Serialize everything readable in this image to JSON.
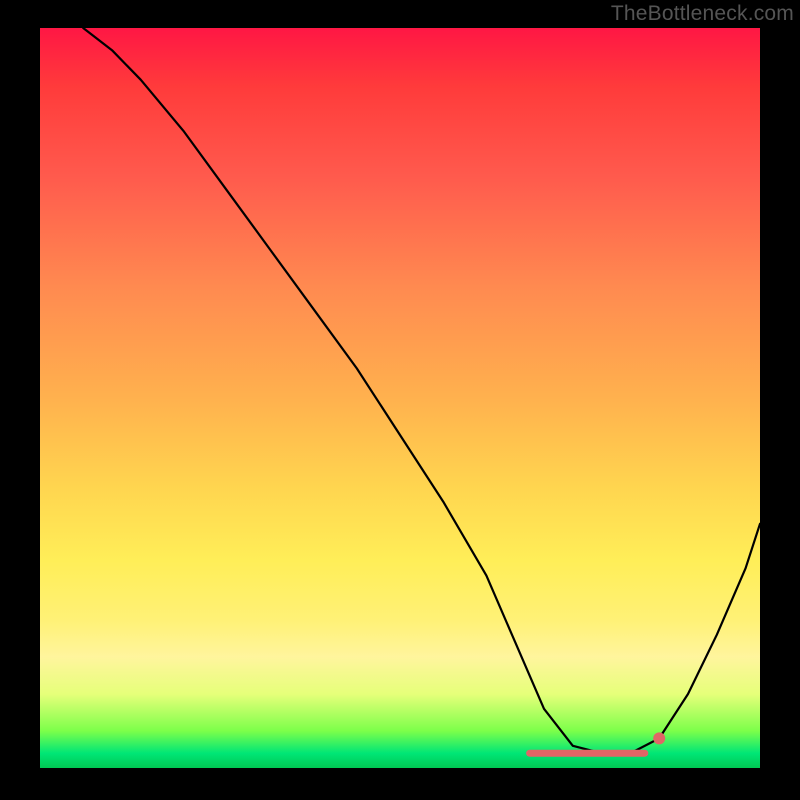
{
  "watermark": "TheBottleneck.com",
  "chart_data": {
    "type": "line",
    "title": "",
    "xlabel": "",
    "ylabel": "",
    "xlim": [
      0,
      100
    ],
    "ylim": [
      0,
      100
    ],
    "note": "V-shaped bottleneck curve over red-to-green gradient; minimum plateau near x≈68–84 at y≈2.",
    "series": [
      {
        "name": "bottleneck-curve",
        "x": [
          6,
          10,
          14,
          20,
          26,
          32,
          38,
          44,
          50,
          56,
          62,
          66,
          70,
          74,
          78,
          82,
          86,
          90,
          94,
          98,
          100
        ],
        "y": [
          100,
          97,
          93,
          86,
          78,
          70,
          62,
          54,
          45,
          36,
          26,
          17,
          8,
          3,
          2,
          2,
          4,
          10,
          18,
          27,
          33
        ]
      }
    ],
    "optimal_region": {
      "x_start": 68,
      "x_end": 84,
      "y": 2
    },
    "marker_dot": {
      "x": 86,
      "y": 4
    },
    "gradient_stops": [
      {
        "pos": 0,
        "color": "#ff1744"
      },
      {
        "pos": 50,
        "color": "#ffb14e"
      },
      {
        "pos": 80,
        "color": "#fff59d"
      },
      {
        "pos": 95,
        "color": "#7cff4a"
      },
      {
        "pos": 100,
        "color": "#00c853"
      }
    ]
  }
}
